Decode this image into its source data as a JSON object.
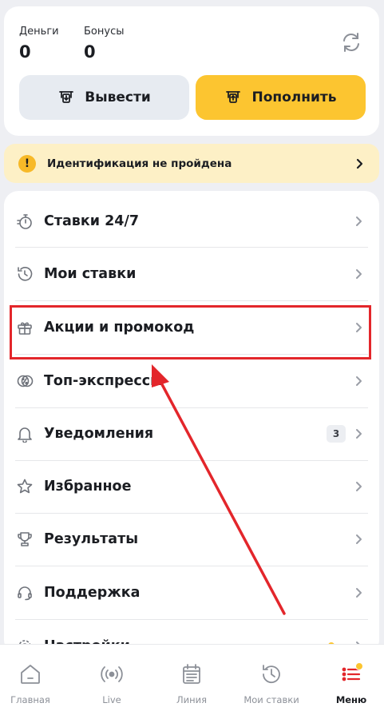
{
  "balance": {
    "money_label": "Деньги",
    "money_value": "0",
    "bonus_label": "Бонусы",
    "bonus_value": "0",
    "refresh_icon": "refresh-icon"
  },
  "actions": {
    "withdraw_label": "Вывести",
    "deposit_label": "Пополнить"
  },
  "notice": {
    "text": "Идентификация не пройдена"
  },
  "menu": {
    "items": [
      {
        "label": "Ставки 24/7",
        "icon": "stopwatch-icon"
      },
      {
        "label": "Мои ставки",
        "icon": "history-icon"
      },
      {
        "label": "Акции и промокод",
        "icon": "gift-icon"
      },
      {
        "label": "Топ-экспрессы",
        "icon": "percent-ticket-icon"
      },
      {
        "label": "Уведомления",
        "icon": "bell-icon",
        "badge": "3"
      },
      {
        "label": "Избранное",
        "icon": "star-icon"
      },
      {
        "label": "Результаты",
        "icon": "trophy-icon"
      },
      {
        "label": "Поддержка",
        "icon": "headset-icon"
      },
      {
        "label": "Настройки",
        "icon": "gear-icon"
      }
    ]
  },
  "tabbar": {
    "tabs": [
      {
        "label": "Главная",
        "icon": "home-icon"
      },
      {
        "label": "Live",
        "icon": "broadcast-icon"
      },
      {
        "label": "Линия",
        "icon": "list-calendar-icon"
      },
      {
        "label": "Мои ставки",
        "icon": "history-icon"
      },
      {
        "label": "Меню",
        "icon": "menu-icon",
        "active": true
      }
    ]
  },
  "colors": {
    "accent": "#fcc530",
    "notice_bg": "#fdf0c6",
    "highlight": "#e3262b",
    "background": "#eeeff3"
  }
}
